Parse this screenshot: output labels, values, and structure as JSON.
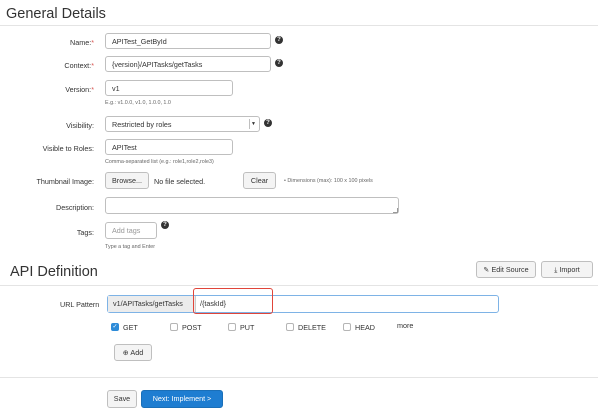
{
  "general": {
    "title": "General Details",
    "name": {
      "label": "Name:",
      "value": "APITest_GetById"
    },
    "context": {
      "label": "Context:",
      "value": "{version}/APITasks/getTasks"
    },
    "version": {
      "label": "Version:",
      "value": "v1",
      "hint": "E.g.: v1.0.0, v1.0, 1.0.0, 1.0"
    },
    "visibility": {
      "label": "Visibility:",
      "value": "Restricted by roles"
    },
    "roles": {
      "label": "Visible to Roles:",
      "value": "APITest",
      "hint": "Comma-separated list (e.g.: role1,role2,role3)"
    },
    "thumbnail": {
      "label": "Thumbnail Image:",
      "browse": "Browse...",
      "file": "No file selected.",
      "clear": "Clear",
      "hint": "Dimensions (max): 100 x 100 pixels"
    },
    "description": {
      "label": "Description:"
    },
    "tags": {
      "label": "Tags:",
      "placeholder": "Add tags",
      "hint": "Type a tag and Enter"
    },
    "required_mark": "*",
    "help_glyph": "?"
  },
  "api": {
    "title": "API Definition",
    "edit_source": "Edit Source",
    "import": "Import",
    "url_pattern_label": "URL Pattern",
    "url_prefix": "v1/APITasks/getTasks",
    "url_value": "/{taskId}",
    "methods": [
      {
        "label": "GET",
        "checked": true
      },
      {
        "label": "POST",
        "checked": false
      },
      {
        "label": "PUT",
        "checked": false
      },
      {
        "label": "DELETE",
        "checked": false
      },
      {
        "label": "HEAD",
        "checked": false
      }
    ],
    "more": "more",
    "add": "Add"
  },
  "footer": {
    "save": "Save",
    "next": "Next: Implement >"
  },
  "colors": {
    "primary": "#1e7dd1",
    "highlight": "#e0453a",
    "required": "#d9534f"
  }
}
